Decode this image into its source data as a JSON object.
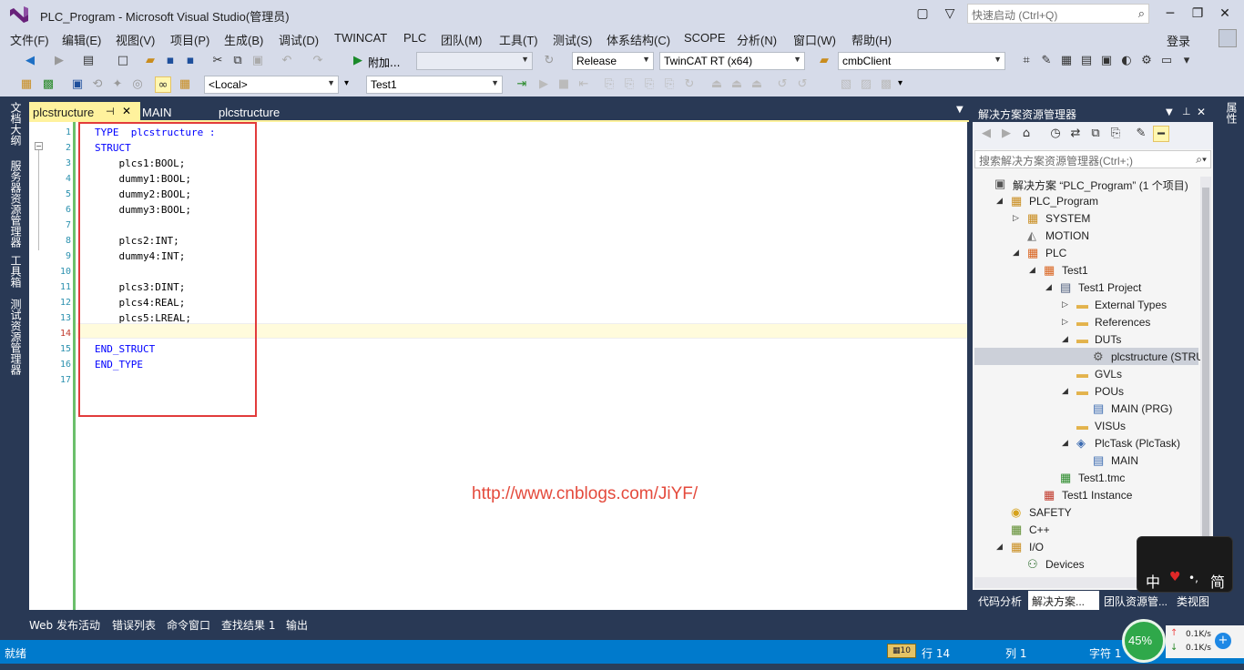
{
  "window": {
    "title": "PLC_Program - Microsoft Visual Studio(管理员)",
    "quick_launch_placeholder": "快速启动 (Ctrl+Q)"
  },
  "menu": {
    "items": [
      "文件(F)",
      "编辑(E)",
      "视图(V)",
      "项目(P)",
      "生成(B)",
      "调试(D)",
      "TWINCAT",
      "PLC",
      "团队(M)",
      "工具(T)",
      "测试(S)",
      "体系结构(C)",
      "SCOPE",
      "分析(N)",
      "窗口(W)",
      "帮助(H)"
    ],
    "sign_in": "登录"
  },
  "toolbar1": {
    "attach_label": "附加...",
    "config": "Release",
    "platform": "TwinCAT RT (x64)",
    "project": "cmbClient"
  },
  "toolbar2": {
    "target": "<Local>",
    "plc_project": "Test1"
  },
  "left_rail": {
    "tabs": [
      "文档大纲",
      "服务器资源管理器",
      "工具箱",
      "测试资源管理器"
    ]
  },
  "right_rail": {
    "tabs": [
      "属性"
    ]
  },
  "doc_tabs": {
    "active": "plcstructure",
    "pin_icon": "⊣",
    "close_icon": "✕",
    "others": [
      "MAIN",
      "plcstructure"
    ]
  },
  "editor": {
    "lines": [
      {
        "n": "1",
        "text": "TYPE  plcstructure :",
        "kw": true
      },
      {
        "n": "2",
        "text": "STRUCT",
        "kw": true
      },
      {
        "n": "3",
        "text": "    plcs1:BOOL;",
        "kw": false
      },
      {
        "n": "4",
        "text": "    dummy1:BOOL;",
        "kw": false
      },
      {
        "n": "5",
        "text": "    dummy2:BOOL;",
        "kw": false
      },
      {
        "n": "6",
        "text": "    dummy3:BOOL;",
        "kw": false
      },
      {
        "n": "7",
        "text": "",
        "kw": false
      },
      {
        "n": "8",
        "text": "    plcs2:INT;",
        "kw": false
      },
      {
        "n": "9",
        "text": "    dummy4:INT;",
        "kw": false
      },
      {
        "n": "10",
        "text": "",
        "kw": false
      },
      {
        "n": "11",
        "text": "    plcs3:DINT;",
        "kw": false
      },
      {
        "n": "12",
        "text": "    plcs4:REAL;",
        "kw": false
      },
      {
        "n": "13",
        "text": "    plcs5:LREAL;",
        "kw": false
      },
      {
        "n": "14",
        "text": "",
        "kw": false
      },
      {
        "n": "15",
        "text": "END_STRUCT",
        "kw": true
      },
      {
        "n": "16",
        "text": "END_TYPE",
        "kw": true
      },
      {
        "n": "17",
        "text": "",
        "kw": false
      }
    ],
    "watermark": "http://www.cnblogs.com/JiYF/"
  },
  "solution_explorer": {
    "title": "解决方案资源管理器",
    "search_placeholder": "搜索解决方案资源管理器(Ctrl+;)",
    "tree": [
      {
        "label": "解决方案 “PLC_Program” (1 个项目)",
        "indent": 0,
        "exp": "",
        "icon": "solution-icon"
      },
      {
        "label": "PLC_Program",
        "indent": 1,
        "exp": "◢",
        "icon": "twincat-project-icon"
      },
      {
        "label": "SYSTEM",
        "indent": 2,
        "exp": "▷",
        "icon": "system-icon"
      },
      {
        "label": "MOTION",
        "indent": 2,
        "exp": "",
        "icon": "motion-icon"
      },
      {
        "label": "PLC",
        "indent": 2,
        "exp": "◢",
        "icon": "plc-icon"
      },
      {
        "label": "Test1",
        "indent": 3,
        "exp": "◢",
        "icon": "plc-project-icon"
      },
      {
        "label": "Test1 Project",
        "indent": 4,
        "exp": "◢",
        "icon": "project-icon"
      },
      {
        "label": "External Types",
        "indent": 5,
        "exp": "▷",
        "icon": "folder-icon"
      },
      {
        "label": "References",
        "indent": 5,
        "exp": "▷",
        "icon": "folder-icon"
      },
      {
        "label": "DUTs",
        "indent": 5,
        "exp": "◢",
        "icon": "folder-icon"
      },
      {
        "label": "plcstructure (STRUCT)",
        "indent": 6,
        "exp": "",
        "icon": "struct-icon"
      },
      {
        "label": "GVLs",
        "indent": 5,
        "exp": "",
        "icon": "folder-icon"
      },
      {
        "label": "POUs",
        "indent": 5,
        "exp": "◢",
        "icon": "folder-icon"
      },
      {
        "label": "MAIN (PRG)",
        "indent": 6,
        "exp": "",
        "icon": "pou-icon"
      },
      {
        "label": "VISUs",
        "indent": 5,
        "exp": "",
        "icon": "folder-icon"
      },
      {
        "label": "PlcTask (PlcTask)",
        "indent": 5,
        "exp": "◢",
        "icon": "task-icon"
      },
      {
        "label": "MAIN",
        "indent": 6,
        "exp": "",
        "icon": "pou-icon"
      },
      {
        "label": "Test1.tmc",
        "indent": 4,
        "exp": "",
        "icon": "tmc-icon"
      },
      {
        "label": "Test1 Instance",
        "indent": 3,
        "exp": "",
        "icon": "instance-icon"
      },
      {
        "label": "SAFETY",
        "indent": 1,
        "exp": "",
        "icon": "safety-icon"
      },
      {
        "label": "C++",
        "indent": 1,
        "exp": "",
        "icon": "cpp-icon"
      },
      {
        "label": "I/O",
        "indent": 1,
        "exp": "◢",
        "icon": "io-icon"
      },
      {
        "label": "Devices",
        "indent": 2,
        "exp": "",
        "icon": "devices-icon"
      }
    ],
    "bottom_tabs": [
      "代码分析",
      "解决方案...",
      "团队资源管...",
      "类视图"
    ]
  },
  "output_tabs": [
    "Web 发布活动",
    "错误列表",
    "命令窗口",
    "查找结果 1",
    "输出"
  ],
  "status": {
    "ready": "就绪",
    "line": "行 14",
    "col": "列 1",
    "char": "字符 1"
  },
  "ime": {
    "zh": "中",
    "jian": "简"
  },
  "net": {
    "percent": "45%",
    "up": "0.1K/s",
    "down": "0.1K/s"
  },
  "colors": {
    "accent_blue": "#007acc",
    "chrome": "#d6dbe9",
    "dark": "#293955",
    "tab_active": "#fff29d",
    "keyword": "#0000ff",
    "line_number": "#2b91af",
    "annotation_red": "#e23b3b"
  }
}
